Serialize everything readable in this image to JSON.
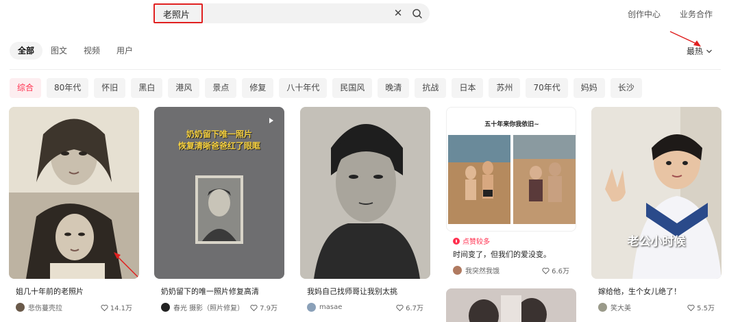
{
  "search": {
    "query": "老照片"
  },
  "topnav": {
    "creator_center": "创作中心",
    "business": "业务合作"
  },
  "tabs": [
    "全部",
    "图文",
    "视频",
    "用户"
  ],
  "sort": {
    "label": "最热"
  },
  "chips": [
    "综合",
    "80年代",
    "怀旧",
    "黑白",
    "港风",
    "景点",
    "修复",
    "八十年代",
    "民国风",
    "晚清",
    "抗战",
    "日本",
    "苏州",
    "70年代",
    "妈妈",
    "长沙"
  ],
  "cards": [
    {
      "title": "姐几十年前的老照片",
      "author": "悲伤蔓壳拉",
      "likes": "14.1万"
    },
    {
      "title": "奶奶留下的唯一照片修复高清",
      "author": "春光 摄影（照片修复）",
      "likes": "7.9万",
      "overlay": "奶奶留下唯一照片\n恢复清晰爸爸红了眼眶"
    },
    {
      "title": "我妈自己找师哥让我别太挑",
      "author": "masae",
      "likes": "6.7万"
    },
    {
      "title": "时间变了，但我们的爱没变。",
      "author": "我突然我饿",
      "likes": "6.6万",
      "badge": "点赞较多",
      "heading": "五十年来你我依旧~"
    },
    {
      "title": "嫁给他，生个女儿绝了！",
      "author": "笑大美",
      "likes": "5.5万",
      "overlay": "老公小时候"
    }
  ],
  "colors": {
    "accent": "#ff2e4d",
    "highlight": "#e02020"
  }
}
